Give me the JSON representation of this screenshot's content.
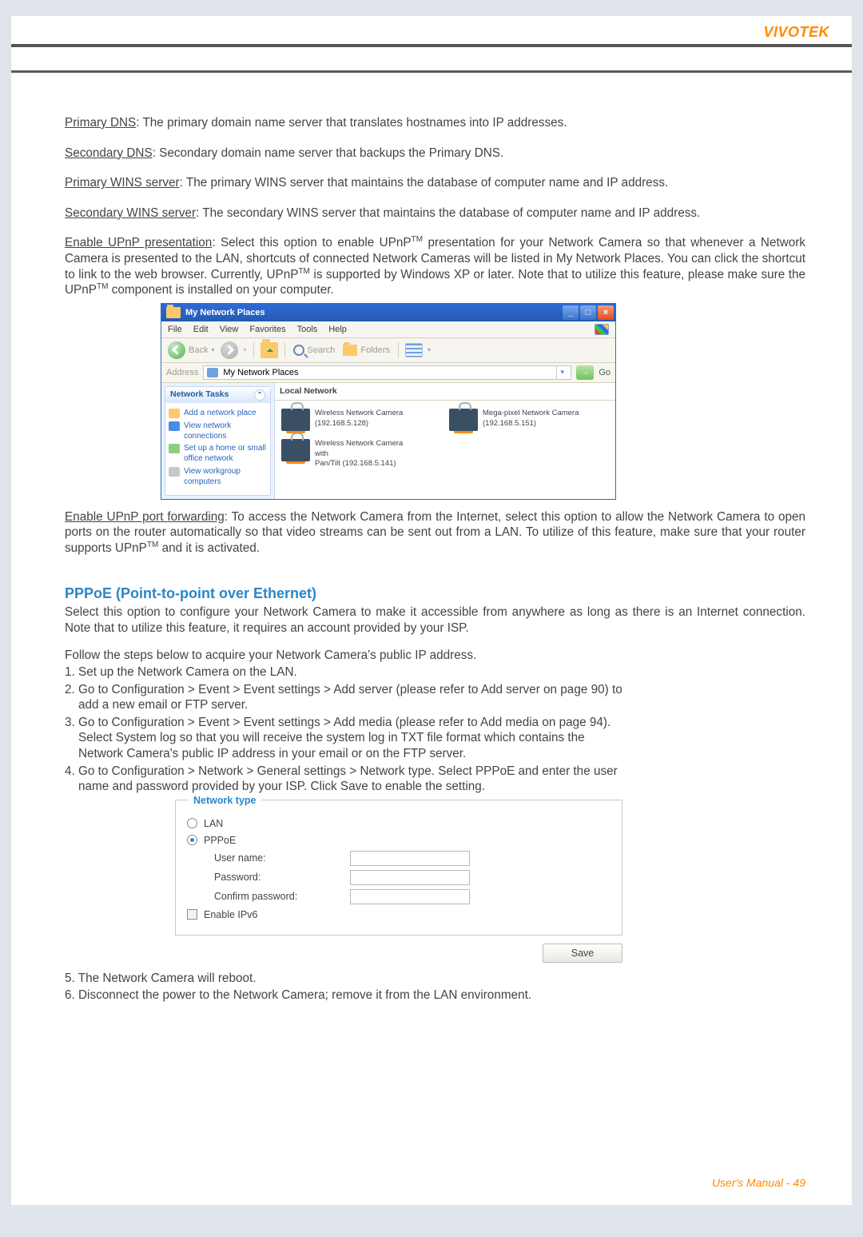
{
  "brand": "VIVOTEK",
  "footer": "User's Manual - 49",
  "defs": {
    "primary_dns_label": "Primary DNS",
    "primary_dns_text": ": The primary domain name server that translates hostnames into IP addresses.",
    "secondary_dns_label": "Secondary DNS",
    "secondary_dns_text": ": Secondary domain name server that backups the Primary DNS.",
    "primary_wins_label": "Primary WINS server",
    "primary_wins_text": ": The primary WINS server that maintains the database of computer name and IP address.",
    "secondary_wins_label": "Secondary WINS server",
    "secondary_wins_text": ": The secondary WINS server that maintains the database of computer name and IP address.",
    "upnp_pres_label": "Enable UPnP presentation",
    "upnp_pres_text_a": ": Select this option to enable UPnP",
    "tm": "TM",
    "upnp_pres_text_b": " presentation for your Network Camera so that whenever a Network Camera is presented to the LAN, shortcuts of connected Network Cameras will be listed in My Network Places. You can click the shortcut to link to the web browser. Currently, UPnP",
    "upnp_pres_text_c": " is supported by Windows XP or later. Note that to utilize this feature, please make sure the UPnP",
    "upnp_pres_text_d": " component is installed on your computer.",
    "upnp_fwd_label": "Enable UPnP port forwarding",
    "upnp_fwd_text_a": ": To access the Network Camera from the Internet, select this option to allow the Network Camera to open ports on the router automatically so that video streams can be sent out from a LAN. To utilize of this feature, make sure that your router supports UPnP",
    "upnp_fwd_text_b": " and it is activated."
  },
  "win": {
    "title": "My Network Places",
    "menus": [
      "File",
      "Edit",
      "View",
      "Favorites",
      "Tools",
      "Help"
    ],
    "back": "Back",
    "search": "Search",
    "folders": "Folders",
    "address_label": "Address",
    "address_value": "My Network Places",
    "go": "Go",
    "tasks_title": "Network Tasks",
    "tasks": [
      "Add a network place",
      "View network connections",
      "Set up a home or small office network",
      "View workgroup computers"
    ],
    "local_header": "Local Network",
    "cam1_line1": "Wireless Network Camera",
    "cam1_line2": "(192.168.5.128)",
    "cam2": "Mega-pixel Network Camera (192.168.5.151)",
    "cam3_line1": "Wireless Network Camera with",
    "cam3_line2": "Pan/Tilt (192.168.5.141)"
  },
  "pppoe": {
    "heading": "PPPoE (Point-to-point over Ethernet)",
    "intro": "Select this option to configure your Network Camera to make it accessible from anywhere as long as there is an Internet connection. Note that to utilize this feature, it requires an account provided by your ISP.",
    "follow": "Follow the steps below to acquire your Network Camera's public IP address.",
    "steps": [
      "1. Set up the Network Camera on the LAN.",
      "2. Go to Configuration > Event > Event settings > Add server (please refer to Add server on page 90) to\n    add a new email or FTP server.",
      "3. Go to Configuration > Event > Event settings > Add media (please refer to Add media on page 94).\n    Select System log so that you will receive the system log in TXT file format which contains the\n    Network Camera's public IP address in your email or on the FTP server.",
      "4. Go to Configuration > Network > General settings > Network type. Select PPPoE and enter the user\n    name and password provided by your ISP. Click Save to enable the setting."
    ],
    "steps_after": [
      "5. The Network Camera will reboot.",
      "6. Disconnect the power to the Network Camera; remove it from the LAN environment."
    ]
  },
  "form": {
    "legend": "Network type",
    "lan": "LAN",
    "pppoe": "PPPoE",
    "user": "User name:",
    "pwd": "Password:",
    "cpwd": "Confirm password:",
    "ipv6": "Enable IPv6",
    "save": "Save"
  }
}
